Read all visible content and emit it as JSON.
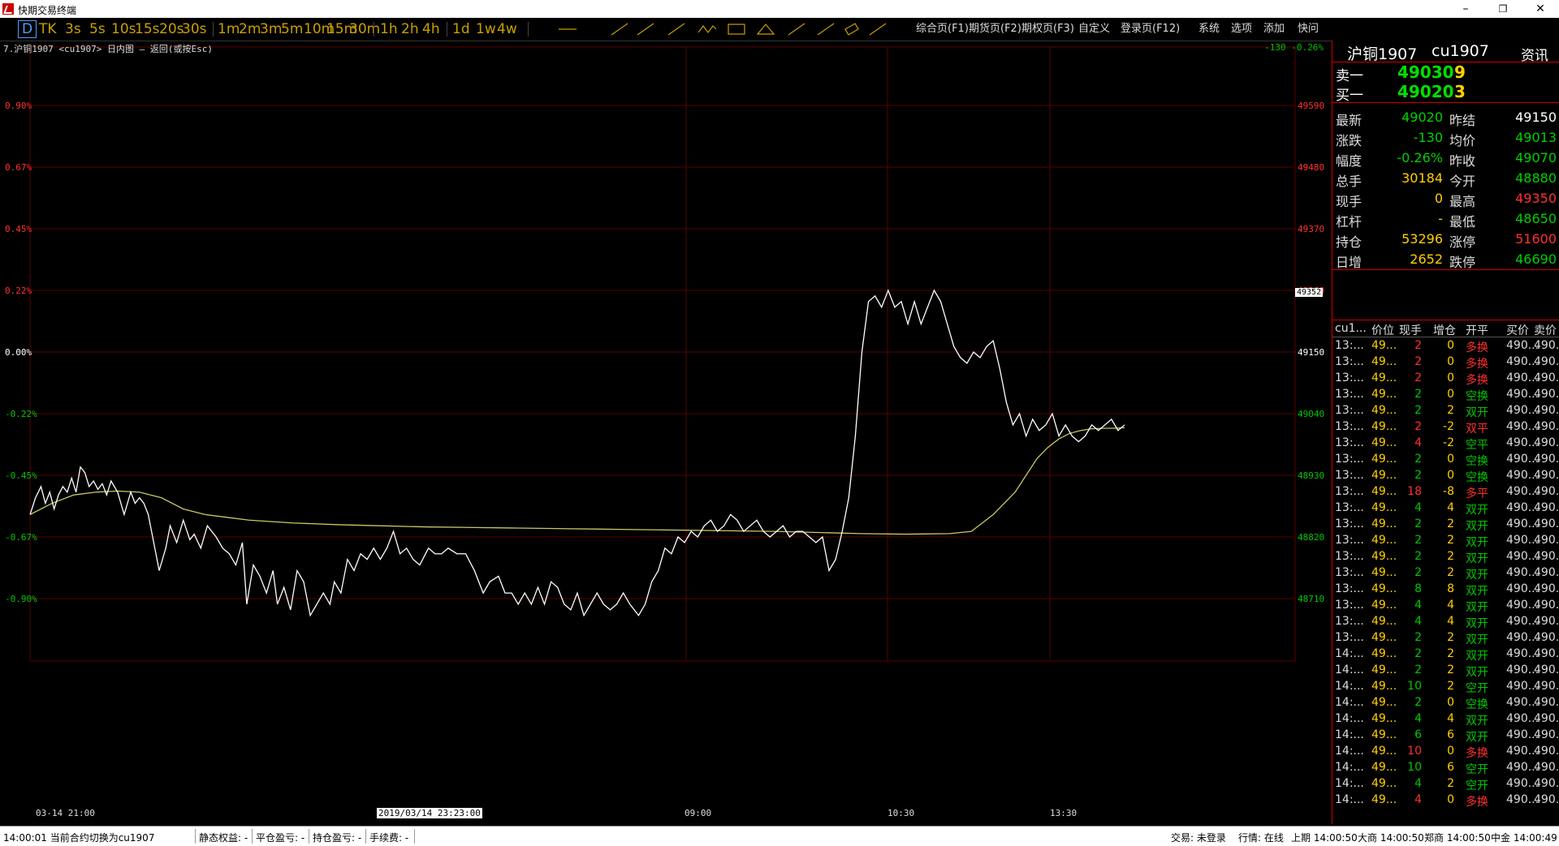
{
  "window": {
    "title": "快期交易终端",
    "minimize": "–",
    "restore": "❐",
    "close": "✕"
  },
  "toolbar": {
    "timeframes": [
      "D",
      "TK",
      "3s",
      "5s",
      "10s",
      "15s",
      "20s",
      "30s",
      "1m",
      "2m",
      "3m",
      "5m",
      "10m",
      "15m",
      "30m",
      "1h",
      "2h",
      "4h",
      "1d",
      "1w",
      "4w"
    ],
    "active": "D",
    "tools": [
      "line-icon",
      "ray-icon",
      "segment-icon",
      "arrow-icon",
      "wave-icon",
      "rectangle-icon",
      "triangle-icon",
      "fib-fan-icon",
      "fib-lines-icon",
      "eraser-icon",
      "hide-icon"
    ],
    "nav": [
      "综合页(F1)",
      "期货页(F2)",
      "期权页(F3)",
      "自定义",
      "登录页(F12)",
      "系统",
      "选项",
      "添加",
      "快问"
    ]
  },
  "chart": {
    "header": "7.沪铜1907 <cu1907> 日内图 — 返回(或按Esc)",
    "top_right": "-130 -0.26%",
    "cursor_price": "49352",
    "x_labels": [
      "03-14 21:00",
      "2019/03/14 23:23:00",
      "09:00",
      "10:30",
      "13:30"
    ],
    "colors": {
      "price_line": "#ffffff",
      "avg_line": "#c8c864",
      "grid": "#5a0000",
      "up": "#ff3030",
      "down": "#00c800"
    }
  },
  "chart_data": {
    "type": "line",
    "title": "7.沪铜1907 <cu1907> 日内图",
    "xlabel": "",
    "ylabel": "",
    "ylim": [
      48600,
      49700
    ],
    "base_price": 49150,
    "y_ticks_price": [
      49590,
      49480,
      49370,
      49260,
      49150,
      49040,
      48930,
      48820,
      48710
    ],
    "y_ticks_pct": [
      "0.90%",
      "0.67%",
      "0.45%",
      "0.22%",
      "0.00%",
      "-0.22%",
      "-0.45%",
      "-0.67%",
      "-0.90%"
    ],
    "x_ticks": [
      "03-14 21:00",
      "09:00",
      "10:30",
      "13:30"
    ],
    "x_range": [
      0,
      1000
    ],
    "series": [
      {
        "values_x": [
          0,
          5,
          10,
          14,
          18,
          22,
          26,
          30,
          34,
          38,
          42,
          46,
          50,
          54,
          58,
          62,
          66,
          70,
          74,
          80,
          86,
          92,
          96,
          100,
          104,
          108,
          112,
          118,
          124,
          128,
          134,
          140,
          146,
          150,
          156,
          162,
          170,
          176,
          182,
          188,
          194,
          198,
          204,
          210,
          216,
          222,
          226,
          232,
          238,
          244,
          250,
          256,
          262,
          268,
          274,
          278,
          284,
          290,
          296,
          302,
          308,
          314,
          320,
          326,
          332,
          338,
          344,
          350,
          356,
          364,
          370,
          376,
          382,
          390,
          398,
          406,
          414,
          420,
          428,
          434,
          440,
          446,
          452,
          458,
          464,
          470,
          476,
          482,
          488,
          494,
          500,
          506,
          512,
          518,
          524,
          530,
          536,
          542,
          548,
          556,
          562,
          568,
          574,
          580,
          586,
          592,
          598,
          604,
          610,
          616,
          622,
          628,
          634,
          640,
          646,
          652,
          658,
          664,
          670,
          676,
          682,
          688,
          694,
          700,
          706,
          712,
          718,
          724,
          730,
          736,
          742,
          748,
          754,
          760,
          766,
          772,
          778,
          784,
          790,
          796,
          802,
          808,
          814,
          820,
          826,
          832,
          838,
          844,
          850,
          856,
          862,
          868,
          874,
          880,
          886,
          892,
          898,
          904,
          910,
          916,
          922,
          928,
          934,
          940,
          946,
          952,
          958,
          964,
          970,
          976,
          982,
          988,
          994,
          1000
        ],
        "values_y": [
          48860,
          48890,
          48910,
          48880,
          48900,
          48870,
          48895,
          48910,
          48900,
          48925,
          48900,
          48945,
          48935,
          48910,
          48920,
          48905,
          48915,
          48895,
          48920,
          48900,
          48860,
          48900,
          48880,
          48890,
          48880,
          48860,
          48820,
          48760,
          48800,
          48840,
          48810,
          48850,
          48815,
          48825,
          48800,
          48840,
          48820,
          48800,
          48790,
          48770,
          48810,
          48700,
          48770,
          48750,
          48720,
          48760,
          48700,
          48730,
          48690,
          48760,
          48740,
          48680,
          48700,
          48720,
          48700,
          48740,
          48720,
          48780,
          48760,
          48790,
          48780,
          48800,
          48780,
          48800,
          48830,
          48790,
          48800,
          48780,
          48770,
          48800,
          48790,
          48790,
          48800,
          48790,
          48790,
          48760,
          48720,
          48740,
          48750,
          48720,
          48720,
          48700,
          48720,
          48700,
          48730,
          48700,
          48740,
          48730,
          48700,
          48690,
          48720,
          48680,
          48700,
          48720,
          48700,
          48690,
          48700,
          48720,
          48700,
          48680,
          48700,
          48740,
          48760,
          48800,
          48790,
          48820,
          48810,
          48830,
          48820,
          48840,
          48850,
          48830,
          48840,
          48860,
          48850,
          48830,
          48840,
          48850,
          48830,
          48820,
          48830,
          48840,
          48820,
          48830,
          48830,
          48820,
          48810,
          48820,
          48760,
          48780,
          48830,
          48890,
          49000,
          49150,
          49240,
          49250,
          49230,
          49260,
          49230,
          49240,
          49200,
          49240,
          49200,
          49230,
          49260,
          49240,
          49200,
          49160,
          49140,
          49130,
          49150,
          49140,
          49160,
          49170,
          49120,
          49060,
          49020,
          49040,
          49000,
          49030,
          49010,
          49020,
          49040,
          49000,
          49020,
          49000,
          48990,
          49000,
          49020,
          49010,
          49020,
          49030,
          49010,
          49020
        ],
        "name": ""
      },
      {
        "values_x": [
          0,
          20,
          40,
          60,
          80,
          100,
          120,
          140,
          160,
          180,
          200,
          240,
          280,
          320,
          360,
          400,
          440,
          480,
          520,
          560,
          600,
          640,
          680,
          720,
          760,
          800,
          840,
          860,
          880,
          900,
          910,
          920,
          930,
          940,
          950,
          960,
          970,
          980,
          990,
          1000
        ],
        "values_y": [
          48860,
          48880,
          48895,
          48900,
          48902,
          48900,
          48890,
          48870,
          48860,
          48855,
          48850,
          48845,
          48842,
          48840,
          48838,
          48837,
          48836,
          48835,
          48834,
          48833,
          48832,
          48831,
          48830,
          48828,
          48826,
          48825,
          48826,
          48830,
          48860,
          48900,
          48930,
          48960,
          48980,
          48995,
          49005,
          49010,
          49013,
          49014,
          49014,
          49015
        ],
        "name": ""
      }
    ]
  },
  "panel": {
    "title_name": "沪铜1907",
    "title_code": "cu1907",
    "title_link": "资讯",
    "sell1": {
      "label": "卖一",
      "price": "49030",
      "vol": "9"
    },
    "buy1": {
      "label": "买一",
      "price": "49020",
      "vol": "3"
    },
    "info": [
      {
        "k1": "最新",
        "v1": "49020",
        "c1": "#00d000",
        "k2": "昨结",
        "v2": "49150",
        "c2": "#ffffff"
      },
      {
        "k1": "涨跌",
        "v1": "-130",
        "c1": "#00d000",
        "k2": "均价",
        "v2": "49013",
        "c2": "#00d000"
      },
      {
        "k1": "幅度",
        "v1": "-0.26%",
        "c1": "#00d000",
        "k2": "昨收",
        "v2": "49070",
        "c2": "#00d000"
      },
      {
        "k1": "总手",
        "v1": "30184",
        "c1": "#ffd000",
        "k2": "今开",
        "v2": "48880",
        "c2": "#00d000"
      },
      {
        "k1": "现手",
        "v1": "0",
        "c1": "#ffd000",
        "k2": "最高",
        "v2": "49350",
        "c2": "#ff3030"
      },
      {
        "k1": "杠杆",
        "v1": "-",
        "c1": "#ffd000",
        "k2": "最低",
        "v2": "48650",
        "c2": "#00d000"
      },
      {
        "k1": "持仓",
        "v1": "53296",
        "c1": "#ffd000",
        "k2": "涨停",
        "v2": "51600",
        "c2": "#ff3030"
      },
      {
        "k1": "日增",
        "v1": "2652",
        "c1": "#ffd000",
        "k2": "跌停",
        "v2": "46690",
        "c2": "#00d000"
      }
    ],
    "trade_headers": [
      "cu1...",
      "价位",
      "现手",
      "增仓",
      "开平",
      "买价",
      "卖价"
    ],
    "trades": [
      [
        "13:...",
        "49...",
        "2",
        "0",
        "多换",
        "490...",
        "490..."
      ],
      [
        "13:...",
        "49...",
        "2",
        "0",
        "多换",
        "490...",
        "490..."
      ],
      [
        "13:...",
        "49...",
        "2",
        "0",
        "多换",
        "490...",
        "490..."
      ],
      [
        "13:...",
        "49...",
        "2",
        "0",
        "空换",
        "490...",
        "490..."
      ],
      [
        "13:...",
        "49...",
        "2",
        "2",
        "双开",
        "490...",
        "490..."
      ],
      [
        "13:...",
        "49...",
        "2",
        "-2",
        "双平",
        "490...",
        "490..."
      ],
      [
        "13:...",
        "49...",
        "4",
        "-2",
        "空平",
        "490...",
        "490..."
      ],
      [
        "13:...",
        "49...",
        "2",
        "0",
        "空换",
        "490...",
        "490..."
      ],
      [
        "13:...",
        "49...",
        "2",
        "0",
        "空换",
        "490...",
        "490..."
      ],
      [
        "13:...",
        "49...",
        "18",
        "-8",
        "多平",
        "490...",
        "490..."
      ],
      [
        "13:...",
        "49...",
        "4",
        "4",
        "双开",
        "490...",
        "490..."
      ],
      [
        "13:...",
        "49...",
        "2",
        "2",
        "双开",
        "490...",
        "490..."
      ],
      [
        "13:...",
        "49...",
        "2",
        "2",
        "双开",
        "490...",
        "490..."
      ],
      [
        "13:...",
        "49...",
        "2",
        "2",
        "双开",
        "490...",
        "490..."
      ],
      [
        "13:...",
        "49...",
        "2",
        "2",
        "双开",
        "490...",
        "490..."
      ],
      [
        "13:...",
        "49...",
        "8",
        "8",
        "双开",
        "490...",
        "490..."
      ],
      [
        "13:...",
        "49...",
        "4",
        "4",
        "双开",
        "490...",
        "490..."
      ],
      [
        "13:...",
        "49...",
        "4",
        "4",
        "双开",
        "490...",
        "490..."
      ],
      [
        "13:...",
        "49...",
        "2",
        "2",
        "双开",
        "490...",
        "490..."
      ],
      [
        "14:...",
        "49...",
        "2",
        "2",
        "双开",
        "490...",
        "490..."
      ],
      [
        "14:...",
        "49...",
        "2",
        "2",
        "双开",
        "490...",
        "490..."
      ],
      [
        "14:...",
        "49...",
        "10",
        "2",
        "空开",
        "490...",
        "490..."
      ],
      [
        "14:...",
        "49...",
        "2",
        "0",
        "空换",
        "490...",
        "490..."
      ],
      [
        "14:...",
        "49...",
        "4",
        "4",
        "双开",
        "490...",
        "490..."
      ],
      [
        "14:...",
        "49...",
        "6",
        "6",
        "双开",
        "490...",
        "490..."
      ],
      [
        "14:...",
        "49...",
        "10",
        "0",
        "多换",
        "490...",
        "490..."
      ],
      [
        "14:...",
        "49...",
        "10",
        "6",
        "空开",
        "490...",
        "490..."
      ],
      [
        "14:...",
        "49...",
        "4",
        "2",
        "空开",
        "490...",
        "490..."
      ],
      [
        "14:...",
        "49...",
        "4",
        "0",
        "多换",
        "490...",
        "490..."
      ]
    ]
  },
  "status": {
    "message": "14:00:01 当前合约切换为cu1907",
    "fields": [
      "静态权益: -",
      "平仓盈亏: -",
      "持仓盈亏: -",
      "手续费: -"
    ],
    "trade": "交易: 未登录",
    "market": "行情: 在线",
    "exchanges": [
      "上期 14:00:50",
      "大商 14:00:50",
      "郑商 14:00:50",
      "中金 14:00:49"
    ]
  }
}
